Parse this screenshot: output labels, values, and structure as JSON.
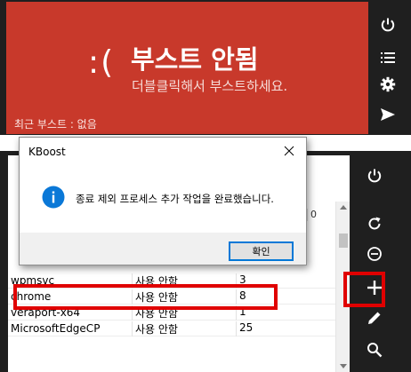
{
  "colors": {
    "boost_red": "#c8392b",
    "panel_dark": "#1f1f1f",
    "highlight_red": "#e00000",
    "info_blue": "#0a78d7"
  },
  "boost_panel": {
    "face": ":(",
    "title": "부스트 안됨",
    "subtitle": "더블클릭해서 부스트하세요.",
    "recent": "최근 부스트 : 없음"
  },
  "top_toolbar": {
    "icons": [
      "power-icon",
      "list-icon",
      "gear-icon",
      "send-icon"
    ]
  },
  "bottom_toolbar": {
    "icons": [
      "power-icon",
      "refresh-icon",
      "remove-icon",
      "add-icon",
      "edit-icon",
      "search-icon"
    ]
  },
  "table": {
    "header_col3": "0",
    "rows": [
      {
        "name": "wpmsvc",
        "status": "사용 안함",
        "count": "3"
      },
      {
        "name": "chrome",
        "status": "사용 안함",
        "count": "8"
      },
      {
        "name": "veraport-x64",
        "status": "사용 안함",
        "count": "1"
      },
      {
        "name": "MicrosoftEdgeCP",
        "status": "사용 안함",
        "count": "25"
      }
    ]
  },
  "dialog": {
    "title": "KBoost",
    "message": "종료 제외 프로세스 추가 작업을 완료했습니다.",
    "ok_label": "확인"
  }
}
